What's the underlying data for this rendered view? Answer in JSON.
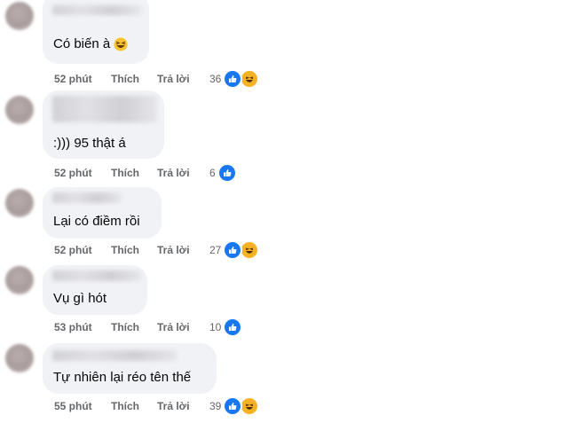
{
  "comments": [
    {
      "text": "Có biến à",
      "emoji": "laughing-emoji",
      "time": "52 phút",
      "like_label": "Thích",
      "reply_label": "Trả lời",
      "reaction_count": "36",
      "reactions": [
        "like",
        "haha"
      ]
    },
    {
      "text": ":))) 95 thật á",
      "time": "52 phút",
      "like_label": "Thích",
      "reply_label": "Trả lời",
      "reaction_count": "6",
      "reactions": [
        "like"
      ]
    },
    {
      "text": "Lại có điềm rồi",
      "time": "52 phút",
      "like_label": "Thích",
      "reply_label": "Trả lời",
      "reaction_count": "27",
      "reactions": [
        "like",
        "haha"
      ]
    },
    {
      "text": "Vụ gì hót",
      "time": "53 phút",
      "like_label": "Thích",
      "reply_label": "Trả lời",
      "reaction_count": "10",
      "reactions": [
        "like"
      ]
    },
    {
      "text": "Tự nhiên lại réo tên thế",
      "time": "55 phút",
      "like_label": "Thích",
      "reply_label": "Trả lời",
      "reaction_count": "39",
      "reactions": [
        "like",
        "haha"
      ]
    }
  ],
  "colors": {
    "like_blue": "#1877f2",
    "haha_yellow": "#f7b125",
    "bubble_bg": "#f0f2f5",
    "meta_gray": "#65676b"
  }
}
